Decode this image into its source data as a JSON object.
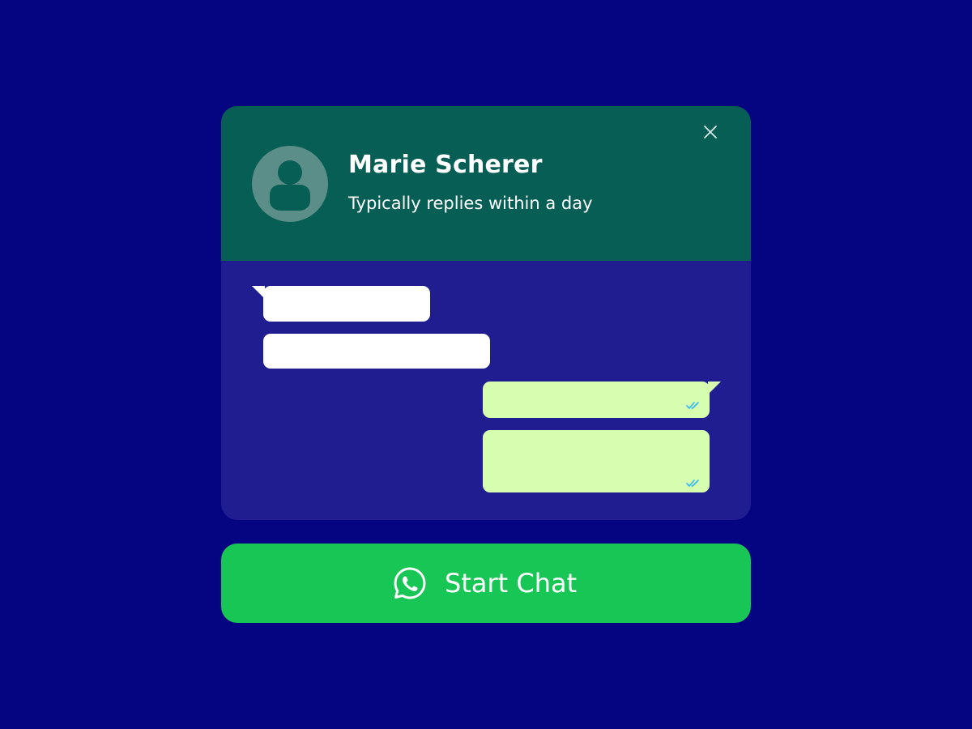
{
  "contact": {
    "name": "Marie Scherer",
    "status": "Typically replies within a day"
  },
  "icons": {
    "avatar": "user-avatar-icon",
    "close": "close-icon",
    "read_receipt": "double-check-icon",
    "start_chat": "whatsapp-icon"
  },
  "conversation": {
    "incoming_count": 2,
    "outgoing_count": 2,
    "outgoing_status": "read"
  },
  "cta": {
    "label": "Start Chat"
  },
  "colors": {
    "page_background": "#050481",
    "header_background": "#075e54",
    "chat_background": "#1f1d8f",
    "incoming_bubble": "#ffffff",
    "outgoing_bubble": "#d7fdb0",
    "read_ticks": "#34b7f1",
    "button_background": "#17c655"
  }
}
